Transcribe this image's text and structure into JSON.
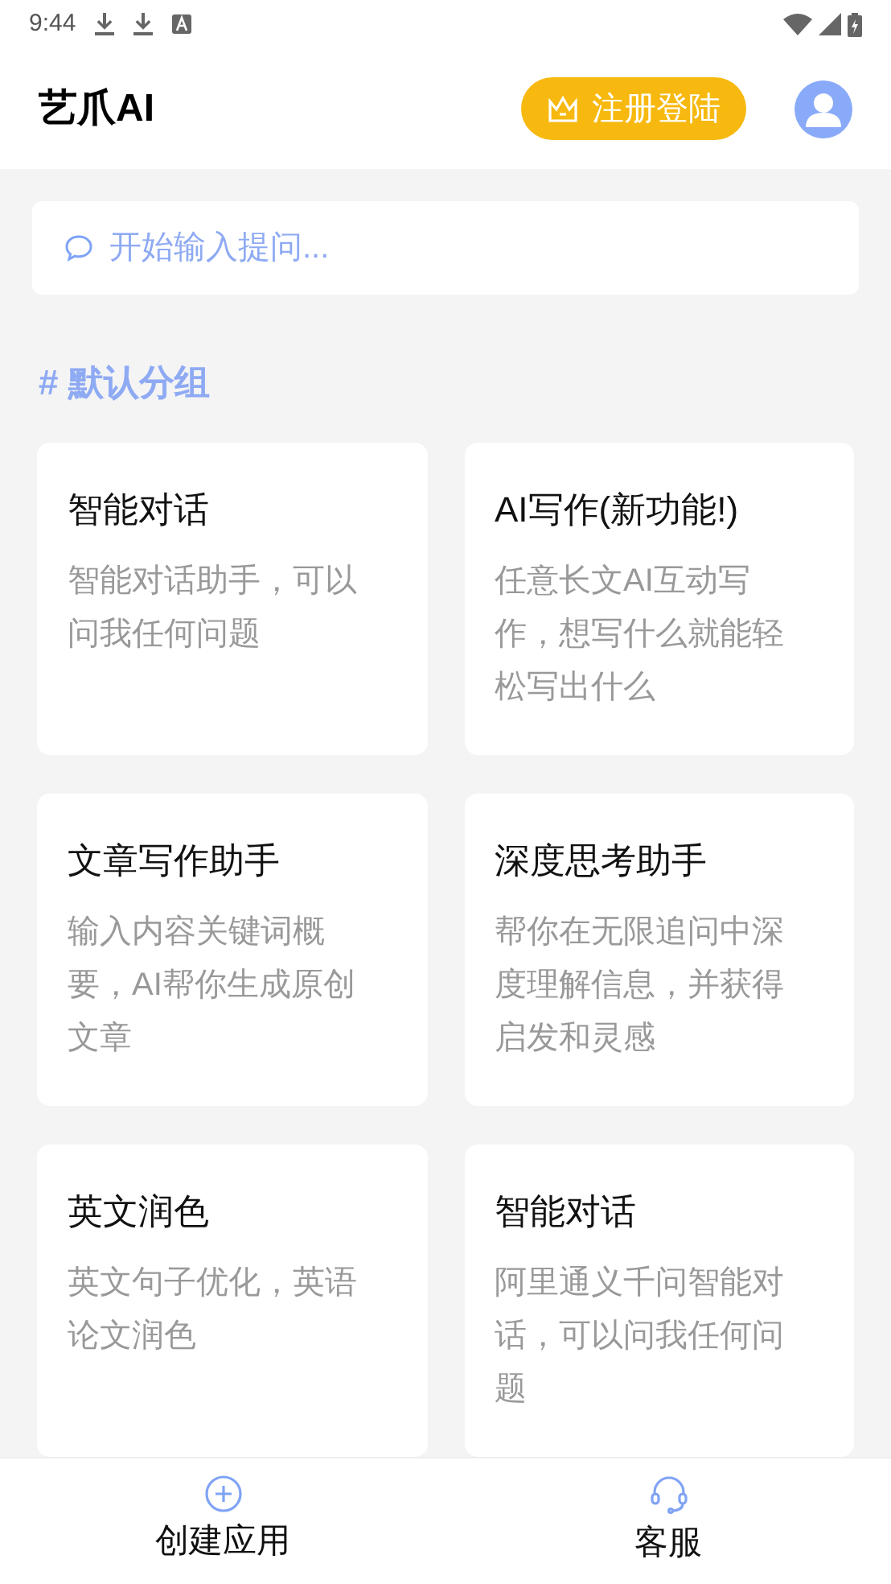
{
  "status_bar": {
    "time": "9:44"
  },
  "header": {
    "title": "艺爪AI",
    "login_button": "注册登陆"
  },
  "search": {
    "placeholder": "开始输入提问..."
  },
  "group": {
    "title": "# 默认分组"
  },
  "cards": [
    {
      "title": "智能对话",
      "description": "智能对话助手，可以问我任何问题"
    },
    {
      "title": "AI写作(新功能!)",
      "description": "任意长文AI互动写作，想写什么就能轻松写出什么"
    },
    {
      "title": "文章写作助手",
      "description": "输入内容关键词概要，AI帮你生成原创文章"
    },
    {
      "title": "深度思考助手",
      "description": "帮你在无限追问中深度理解信息，并获得启发和灵感"
    },
    {
      "title": "英文润色",
      "description": "英文句子优化，英语论文润色"
    },
    {
      "title": "智能对话",
      "description": "阿里通义千问智能对话，可以问我任何问题"
    }
  ],
  "bottom_nav": [
    {
      "kind": "create",
      "label": "创建应用"
    },
    {
      "kind": "service",
      "label": "客服"
    }
  ]
}
